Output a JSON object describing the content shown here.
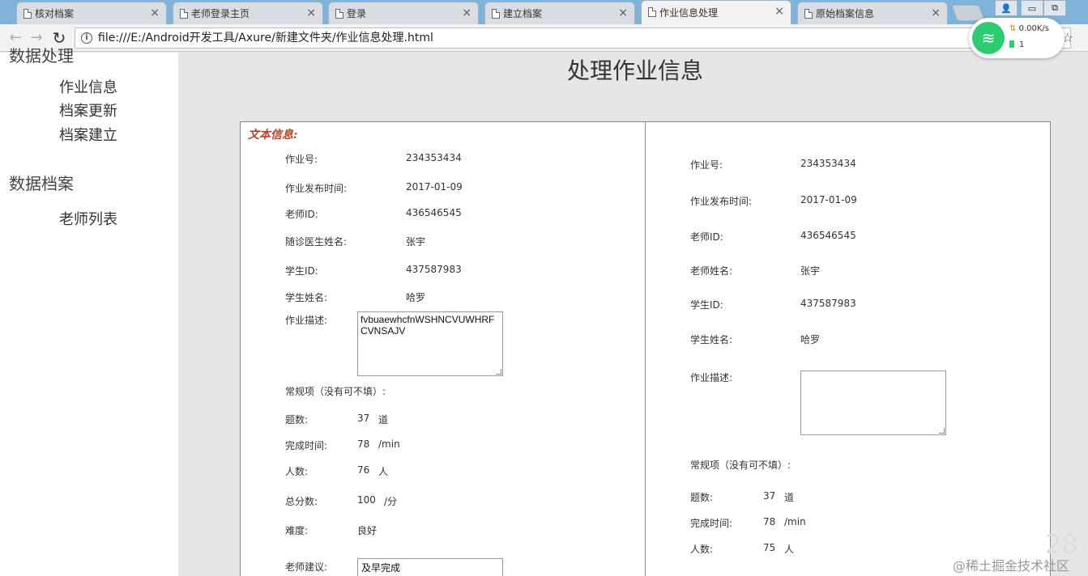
{
  "browser": {
    "tabs": [
      {
        "title": "核对档案",
        "close": "×"
      },
      {
        "title": "老师登录主页",
        "close": "×"
      },
      {
        "title": "登录",
        "close": "×"
      },
      {
        "title": "建立档案",
        "close": "×"
      },
      {
        "title": "作业信息处理",
        "close": "×"
      },
      {
        "title": "原始档案信息",
        "close": "×"
      }
    ],
    "active_tab": 4,
    "url": "file:///E:/Android开发工具/Axure/新建文件夹/作业信息处理.html",
    "back": "←",
    "forward": "→",
    "reload": "↻",
    "star": "☆",
    "info": "i",
    "window_controls": {
      "user": "👤",
      "minimize": "▭",
      "restore": "⧉"
    }
  },
  "net_widget": {
    "speed": "0.00K/s",
    "count": "1",
    "arrows": "⇅"
  },
  "sidebar": {
    "section1_title": "数据处理",
    "section1_items": [
      "作业信息",
      "档案更新",
      "档案建立"
    ],
    "section2_title": "数据档案",
    "section2_items": [
      "老师列表"
    ]
  },
  "page_title": "处理作业信息",
  "left": {
    "section_label": "文本信息:",
    "homework_no_label": "作业号:",
    "homework_no": "234353434",
    "publish_time_label": "作业发布时间:",
    "publish_time": "2017-01-09",
    "teacher_id_label": "老师ID:",
    "teacher_id": "436546545",
    "doctor_name_label": "随诊医生姓名:",
    "doctor_name": "张宇",
    "student_id_label": "学生ID:",
    "student_id": "437587983",
    "student_name_label": "学生姓名:",
    "student_name": "哈罗",
    "description_label": "作业描述:",
    "description": "fvbuaewhcfnWSHNCVUWHRFCVNSAJV",
    "regular_label": "常规项（没有可不填）:",
    "questions_label": "题数:",
    "questions": "37",
    "questions_unit": "道",
    "finish_time_label": "完成时间:",
    "finish_time": "78",
    "finish_time_unit": "/min",
    "people_label": "人数:",
    "people": "76",
    "people_unit": "人",
    "total_label": "总分数:",
    "total": "100",
    "total_unit": "/分",
    "difficulty_label": "难度:",
    "difficulty": "良好",
    "advice_label": "老师建议:",
    "advice": "及早完成"
  },
  "right": {
    "homework_no_label": "作业号:",
    "homework_no": "234353434",
    "publish_time_label": "作业发布时间:",
    "publish_time": "2017-01-09",
    "teacher_id_label": "老师ID:",
    "teacher_id": "436546545",
    "teacher_name_label": "老师姓名:",
    "teacher_name": "张宇",
    "student_id_label": "学生ID:",
    "student_id": "437587983",
    "student_name_label": "学生姓名:",
    "student_name": "哈罗",
    "description_label": "作业描述:",
    "description": "",
    "regular_label": "常规项（没有可不填）:",
    "questions_label": "题数:",
    "questions": "37",
    "questions_unit": "道",
    "finish_time_label": "完成时间:",
    "finish_time": "78",
    "finish_time_unit": "/min",
    "people_label": "人数:",
    "people": "75",
    "people_unit": "人"
  },
  "watermark": "@稀土掘金技术社区",
  "corner_number": "28"
}
